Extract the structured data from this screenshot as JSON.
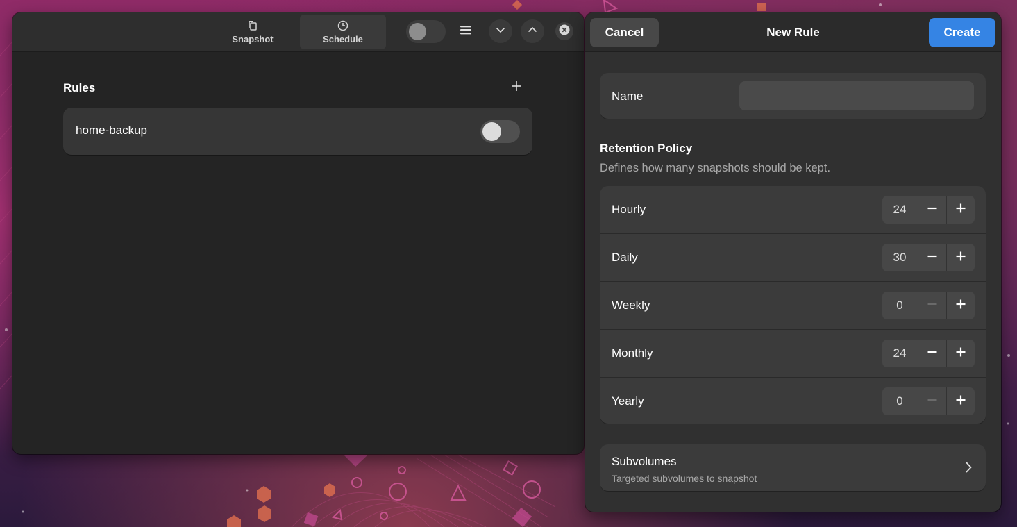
{
  "colors": {
    "accent": "#3584e4",
    "window_bg": "#242424",
    "dialog_bg": "#303030",
    "card_bg": "#3b3b3b"
  },
  "headerbar": {
    "tabs": [
      {
        "label": "Snapshot",
        "icon": "snapshot-icon",
        "active": false
      },
      {
        "label": "Schedule",
        "icon": "clock-icon",
        "active": true
      }
    ],
    "toggle_on": false,
    "icons": [
      "hamburger-menu-icon",
      "chevron-down-icon",
      "chevron-up-icon",
      "close-icon"
    ]
  },
  "rules": {
    "title": "Rules",
    "add_icon": "plus-icon",
    "items": [
      {
        "label": "home-backup",
        "enabled": false
      }
    ]
  },
  "dialog": {
    "cancel_label": "Cancel",
    "title": "New Rule",
    "create_label": "Create",
    "name_label": "Name",
    "name_value": "",
    "retention": {
      "title": "Retention Policy",
      "subtitle": "Defines how many snapshots should be kept.",
      "rows": [
        {
          "label": "Hourly",
          "value": "24",
          "minus_enabled": true
        },
        {
          "label": "Daily",
          "value": "30",
          "minus_enabled": true
        },
        {
          "label": "Weekly",
          "value": "0",
          "minus_enabled": false
        },
        {
          "label": "Monthly",
          "value": "24",
          "minus_enabled": true
        },
        {
          "label": "Yearly",
          "value": "0",
          "minus_enabled": false
        }
      ]
    },
    "subvolumes": {
      "title": "Subvolumes",
      "subtitle": "Targeted subvolumes to snapshot",
      "icon": "chevron-right-icon"
    }
  }
}
